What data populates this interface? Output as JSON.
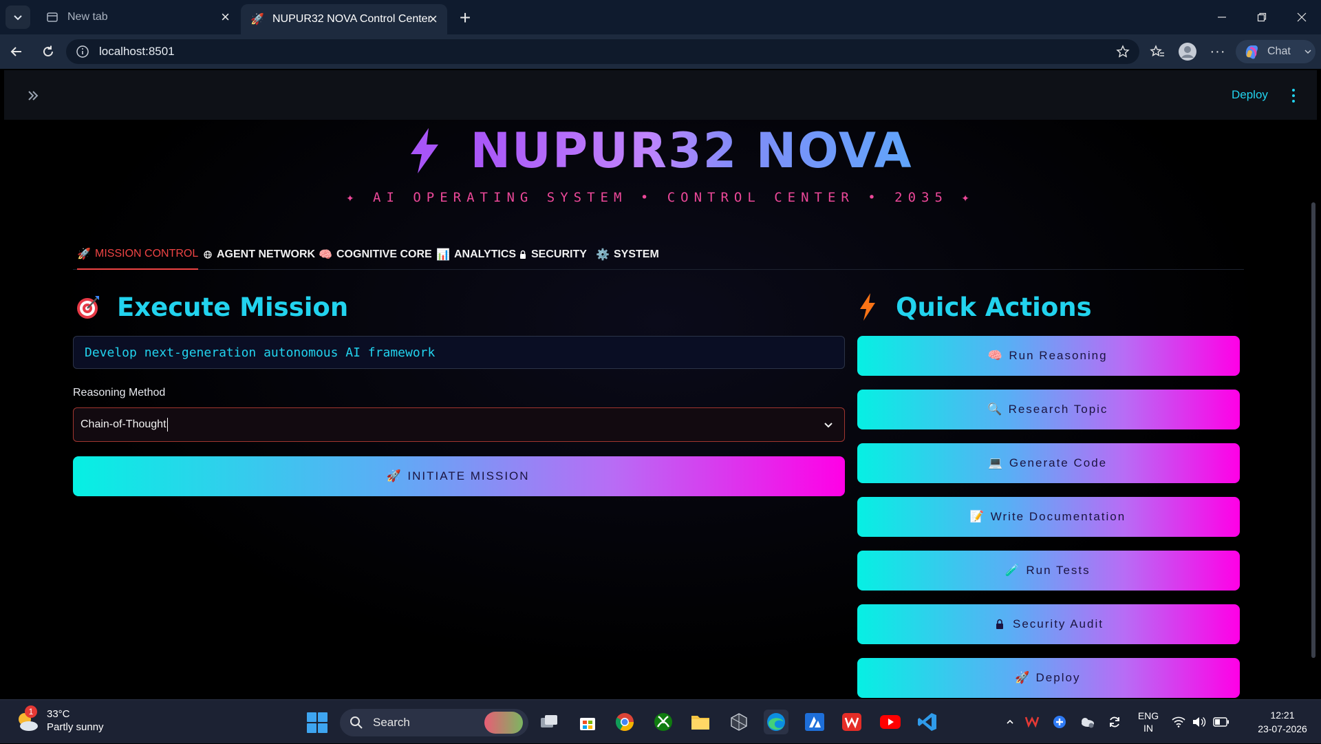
{
  "browser": {
    "tabs": [
      {
        "label": "New tab",
        "active": false
      },
      {
        "label": "NUPUR32 NOVA Control Center",
        "active": true
      }
    ],
    "url": "localhost:8501",
    "chat_label": "Chat"
  },
  "app_header": {
    "deploy_label": "Deploy"
  },
  "hero": {
    "title": "NUPUR32 NOVA",
    "subtitle": "✦ AI OPERATING SYSTEM • CONTROL CENTER • 2035 ✦"
  },
  "nav_tabs": [
    {
      "icon": "rocket-icon",
      "label": "MISSION CONTROL",
      "active": true
    },
    {
      "icon": "globe-icon",
      "label": "AGENT NETWORK",
      "active": false
    },
    {
      "icon": "brain-icon",
      "label": "COGNITIVE CORE",
      "active": false
    },
    {
      "icon": "bar-chart-icon",
      "label": "ANALYTICS",
      "active": false
    },
    {
      "icon": "lock-icon",
      "label": "SECURITY",
      "active": false
    },
    {
      "icon": "gear-icon",
      "label": "SYSTEM",
      "active": false
    }
  ],
  "mission": {
    "heading": "Execute Mission",
    "input_value": "Develop next-generation autonomous AI framework",
    "reasoning_label": "Reasoning Method",
    "reasoning_value": "Chain-of-Thought",
    "initiate_label": "INITIATE MISSION"
  },
  "quick_actions": {
    "heading": "Quick Actions",
    "buttons": [
      {
        "icon": "brain-icon",
        "label": "Run Reasoning"
      },
      {
        "icon": "magnifier-icon",
        "label": "Research Topic"
      },
      {
        "icon": "laptop-icon",
        "label": "Generate Code"
      },
      {
        "icon": "memo-icon",
        "label": "Write Documentation"
      },
      {
        "icon": "test-tube-icon",
        "label": "Run Tests"
      },
      {
        "icon": "lock-icon",
        "label": "Security Audit"
      },
      {
        "icon": "rocket-icon",
        "label": "Deploy"
      }
    ]
  },
  "taskbar": {
    "weather_temp": "33°C",
    "weather_desc": "Partly sunny",
    "weather_badge": "1",
    "search_placeholder": "Search",
    "lang_line1": "ENG",
    "lang_line2": "IN",
    "time": "12:21",
    "date": "23-07-2026"
  },
  "colors": {
    "accent_cyan": "#22d3ee",
    "accent_pink": "#ec4899",
    "active_tab": "#ef4444",
    "button_gradient_start": "#06f0e3",
    "button_gradient_end": "#ff00e6"
  }
}
